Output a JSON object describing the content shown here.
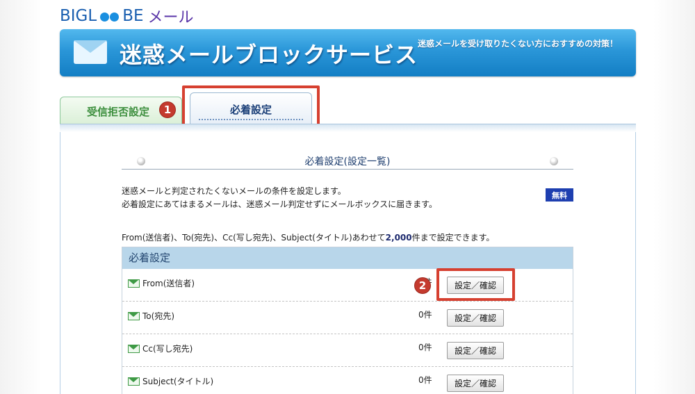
{
  "header": {
    "logo_brand_left": "BIGL",
    "logo_brand_right": "BE",
    "logo_service": "メール",
    "banner_title": "迷惑メールブロックサービス",
    "banner_tagline": "迷惑メールを受け取りたくない方におすすめの対策！"
  },
  "tabs": [
    {
      "label": "受信拒否設定",
      "active": false
    },
    {
      "label": "必着設定",
      "active": true
    }
  ],
  "markers": {
    "first": "1",
    "second": "2"
  },
  "section": {
    "title": "必着設定(設定一覧)",
    "desc_line1": "迷惑メールと判定されたくないメールの条件を設定します。",
    "desc_line2": "必着設定にあてはまるメールは、迷惑メール判定せずにメールボックスに届きます。",
    "free_badge": "無料",
    "limit_prefix": "From(送信者)、To(宛先)、Cc(写し宛先)、Subject(タイトル)あわせて",
    "limit_number": "2,000",
    "limit_suffix": "件まで設定できます。"
  },
  "list": {
    "header": "必着設定",
    "rows": [
      {
        "label": "From(送信者)",
        "count": "0件",
        "button": "設定／確認"
      },
      {
        "label": "To(宛先)",
        "count": "0件",
        "button": "設定／確認"
      },
      {
        "label": "Cc(写し宛先)",
        "count": "0件",
        "button": "設定／確認"
      },
      {
        "label": "Subject(タイトル)",
        "count": "0件",
        "button": "設定／確認"
      }
    ]
  },
  "colors": {
    "banner": "#2a96d8",
    "highlight": "#d64030",
    "list_header": "#b8d6ea",
    "free_badge": "#1e3fb0"
  }
}
